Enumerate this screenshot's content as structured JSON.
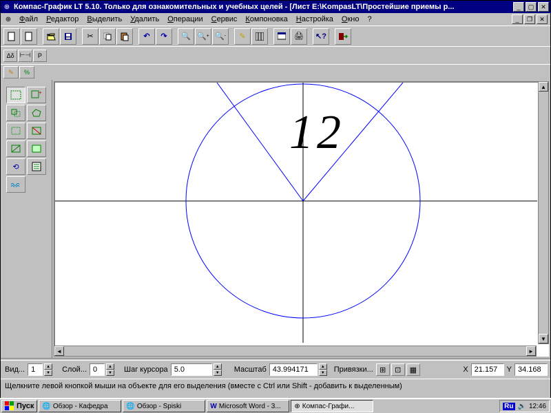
{
  "titlebar": {
    "text": "Компас-График LT 5.10. Только для ознакомительных и учебных целей - [Лист E:\\KompasLT\\Простейшие приемы р..."
  },
  "menu": {
    "file": "Файл",
    "editor": "Редактор",
    "select": "Выделить",
    "delete": "Удалить",
    "operations": "Операции",
    "service": "Сервис",
    "layout": "Компоновка",
    "settings": "Настройка",
    "window": "Окно",
    "help": "?"
  },
  "small_tabs": {
    "t1": "Δδ",
    "t2": "⊢⊣",
    "t3": "P",
    "t4": "✎",
    "t5": "%"
  },
  "param_bar": {
    "view_label": "Вид...",
    "view_val": "1",
    "layer_label": "Слой...",
    "layer_val": "0",
    "step_label": "Шаг курсора",
    "step_val": "5.0",
    "scale_label": "Масштаб",
    "scale_val": "43.994171",
    "snap_label": "Привязки...",
    "x_label": "X",
    "x_val": "21.157",
    "y_label": "Y",
    "y_val": "34.168"
  },
  "status": {
    "text": "Щелкните левой кнопкой мыши на объекте для его выделения (вместе с Ctrl или Shift - добавить к выделенным)"
  },
  "canvas": {
    "num1": "1",
    "num2": "2"
  },
  "taskbar": {
    "start": "Пуск",
    "t1": "Обзор - Кафедра",
    "t2": "Обзор - Spiski",
    "t3": "Microsoft Word - 3...",
    "t4": "Компас-Графи...",
    "lang": "Ru",
    "clock": "12:46"
  }
}
